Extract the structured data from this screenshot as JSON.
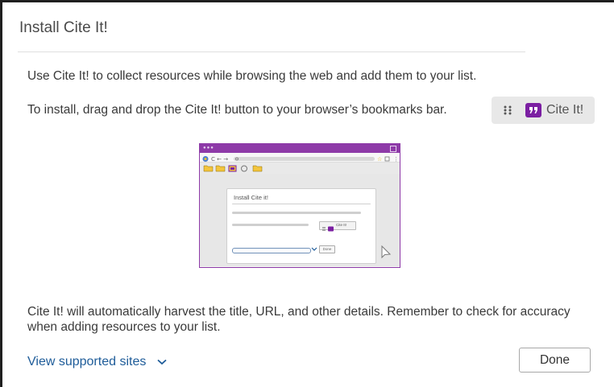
{
  "dialog": {
    "title": "Install Cite It!",
    "description": "Use Cite It! to collect resources while browsing the web and add them to your list.",
    "install_instruction": "To install, drag and drop the Cite It! button to your browser’s bookmarks bar.",
    "cite_button_label": "Cite It!",
    "illustration": {
      "dialog_title": "Install Cite it!",
      "cite_label": "Cite It!",
      "done_label": "Done"
    },
    "harvest_note": "Cite It! will automatically harvest the title, URL, and other details. Remember to check for accuracy when adding resources to your list.",
    "view_supported_label": "View supported sites",
    "done_label": "Done"
  },
  "colors": {
    "accent_purple": "#7b1fa2",
    "link_blue": "#1e5c99"
  }
}
